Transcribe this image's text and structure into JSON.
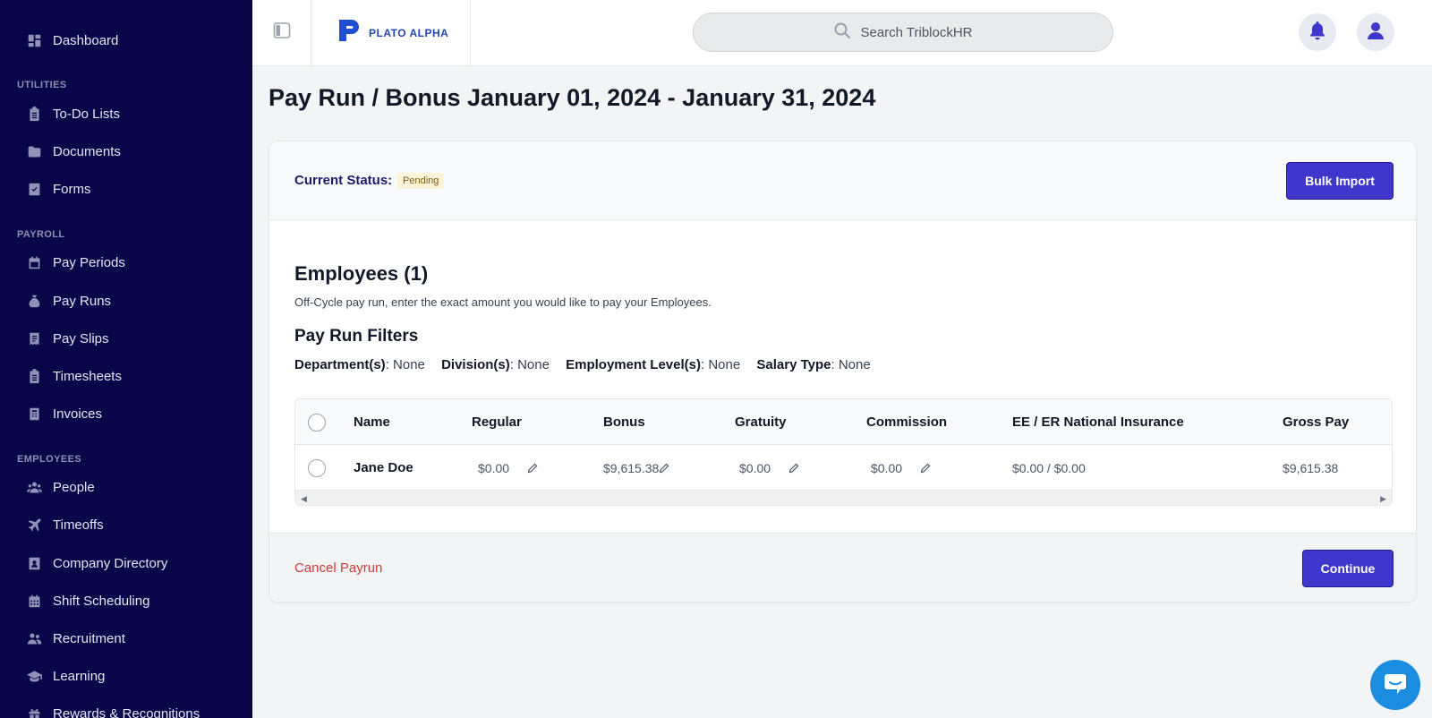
{
  "sidebar": {
    "dashboard": "Dashboard",
    "utilities_heading": "UTILITIES",
    "utilities": [
      "To-Do Lists",
      "Documents",
      "Forms"
    ],
    "payroll_heading": "PAYROLL",
    "payroll": [
      "Pay Periods",
      "Pay Runs",
      "Pay Slips",
      "Timesheets",
      "Invoices"
    ],
    "employees_heading": "EMPLOYEES",
    "employees": [
      "People",
      "Timeoffs",
      "Company Directory",
      "Shift Scheduling",
      "Recruitment",
      "Learning",
      "Rewards & Recognitions"
    ]
  },
  "topbar": {
    "brand": "PLATO ALPHA",
    "search_placeholder": "Search TriblockHR"
  },
  "page": {
    "title": "Pay Run / Bonus January 01, 2024 - January 31, 2024"
  },
  "status": {
    "label": "Current Status:",
    "value": "Pending",
    "bulk_import": "Bulk Import"
  },
  "employees": {
    "title": "Employees (1)",
    "description": "Off-Cycle pay run, enter the exact amount you would like to pay your Employees."
  },
  "filters": {
    "title": "Pay Run Filters",
    "items": [
      {
        "label": "Department(s)",
        "value": ": None"
      },
      {
        "label": "Division(s)",
        "value": ": None"
      },
      {
        "label": "Employment Level(s)",
        "value": ": None"
      },
      {
        "label": "Salary Type",
        "value": ": None"
      }
    ]
  },
  "table": {
    "headers": {
      "name": "Name",
      "regular": "Regular",
      "bonus": "Bonus",
      "gratuity": "Gratuity",
      "commission": "Commission",
      "ni": "EE / ER National Insurance",
      "gross": "Gross Pay"
    },
    "rows": [
      {
        "name": "Jane Doe",
        "regular": "$0.00",
        "bonus": "$9,615.38",
        "gratuity": "$0.00",
        "commission": "$0.00",
        "ni": "$0.00 / $0.00",
        "gross": "$9,615.38"
      }
    ]
  },
  "footer": {
    "cancel": "Cancel Payrun",
    "continue": "Continue"
  },
  "colors": {
    "sidebar_bg": "#0a0548",
    "primary": "#3f36cc",
    "danger": "#d03a3a",
    "badge_bg": "#fdf3d8"
  }
}
